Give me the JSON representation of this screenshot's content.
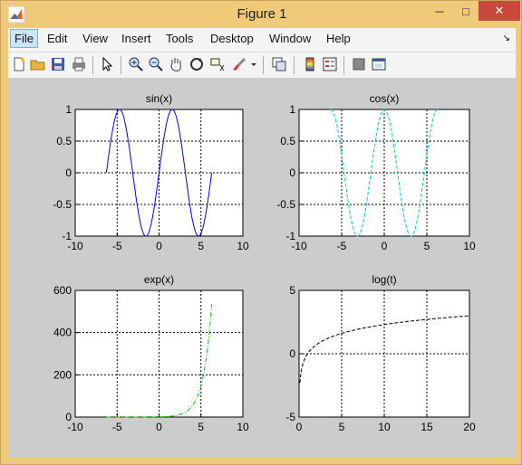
{
  "window": {
    "title": "Figure 1",
    "controls": {
      "minimize": "─",
      "maximize": "□",
      "close": "✕"
    }
  },
  "menubar": {
    "items": [
      "File",
      "Edit",
      "View",
      "Insert",
      "Tools",
      "Desktop",
      "Window",
      "Help"
    ],
    "dock_arrow": "↘"
  },
  "toolbar": {
    "icons": [
      "new-figure-icon",
      "open-file-icon",
      "save-icon",
      "print-icon",
      "select-arrow-icon",
      "zoom-in-icon",
      "zoom-out-icon",
      "pan-hand-icon",
      "rotate-3d-icon",
      "data-cursor-icon",
      "brush-icon",
      "brush-dropdown-icon",
      "link-plot-icon",
      "colorbar-icon",
      "legend-icon",
      "hide-plot-tools-icon",
      "show-plot-tools-icon"
    ]
  },
  "chart_data": [
    {
      "type": "line",
      "title": "sin(x)",
      "xlim": [
        -10,
        10
      ],
      "ylim": [
        -1,
        1
      ],
      "xticks": [
        "-10",
        "-5",
        "0",
        "5",
        "10"
      ],
      "yticks": [
        "1",
        "0.5",
        "0",
        "-0.5",
        "-1"
      ],
      "color": "#0000ff",
      "dash": "solid",
      "grid": true,
      "function": "sin",
      "x_range": [
        -6.28,
        6.28
      ]
    },
    {
      "type": "line",
      "title": "cos(x)",
      "xlim": [
        -10,
        10
      ],
      "ylim": [
        -1,
        1
      ],
      "xticks": [
        "-10",
        "-5",
        "0",
        "5",
        "10"
      ],
      "yticks": [
        "1",
        "0.5",
        "0",
        "-0.5",
        "-1"
      ],
      "color": "#00cccc",
      "dash": "dashed",
      "grid": true,
      "function": "cos",
      "x_range": [
        -6.28,
        6.28
      ]
    },
    {
      "type": "line",
      "title": "exp(x)",
      "xlim": [
        -10,
        10
      ],
      "ylim": [
        0,
        600
      ],
      "xticks": [
        "-10",
        "-5",
        "0",
        "5",
        "10"
      ],
      "yticks": [
        "600",
        "400",
        "200",
        "0"
      ],
      "color": "#00cc00",
      "dash": "dashdot",
      "grid": true,
      "function": "exp",
      "x_range": [
        -6.28,
        6.28
      ]
    },
    {
      "type": "line",
      "title": "log(t)",
      "xlim": [
        0,
        20
      ],
      "ylim": [
        -5,
        5
      ],
      "xticks": [
        "0",
        "5",
        "10",
        "15",
        "20"
      ],
      "yticks": [
        "5",
        "0",
        "-5"
      ],
      "color": "#000000",
      "dash": "dashed",
      "grid": true,
      "function": "log",
      "x_range": [
        0.1,
        20
      ]
    }
  ]
}
